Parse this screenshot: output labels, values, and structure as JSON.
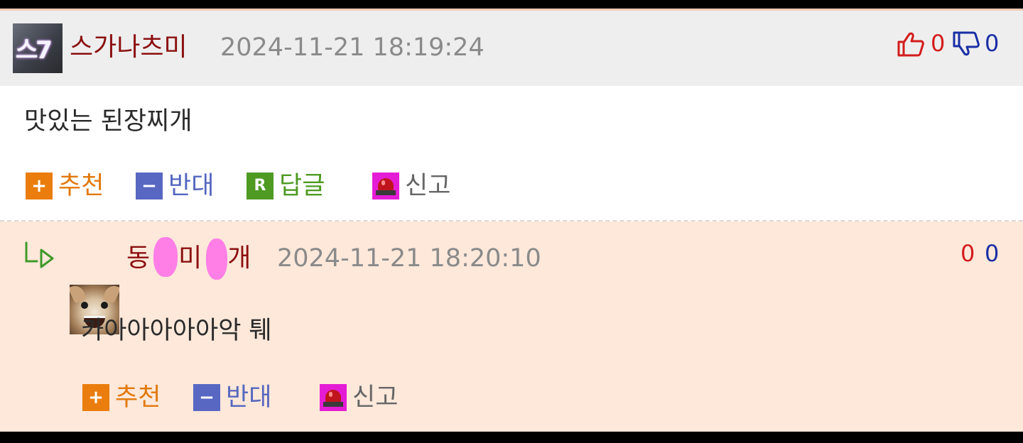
{
  "comments": [
    {
      "nickname": "스가나츠미",
      "datetime": "2024-11-21 18:19:24",
      "avatar_text": "스7",
      "up_count": "0",
      "down_count": "0",
      "body": "맛있는 된장찌개",
      "actions": {
        "recommend": "추천",
        "oppose": "반대",
        "reply": "답글",
        "reply_badge": "R",
        "report": "신고"
      }
    },
    {
      "nickname_parts": [
        "동",
        "미",
        "개"
      ],
      "datetime": "2024-11-21 18:20:10",
      "up_count": "0",
      "down_count": "0",
      "body": "카아아아아아악 퉤",
      "actions": {
        "recommend": "추천",
        "oppose": "반대",
        "report": "신고"
      }
    }
  ],
  "icons": {
    "plus": "+",
    "minus": "−",
    "thumbs_up": "thumbs-up-icon",
    "thumbs_down": "thumbs-down-icon",
    "reply_arrow": "reply-arrow-icon",
    "siren": "siren-icon"
  },
  "colors": {
    "nickname": "#8b0f0f",
    "up": "#d41c1c",
    "down": "#1a2ea5",
    "recommend": "#ea7d0d",
    "oppose": "#5867c2",
    "reply": "#4e9a22",
    "report_badge": "#e51cd6",
    "reply_bg": "#fde8da",
    "header_bg": "#eeeeee"
  }
}
